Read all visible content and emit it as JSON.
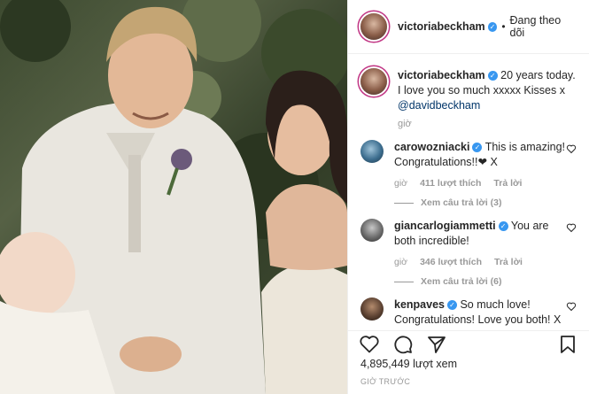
{
  "post": {
    "account": "victoriabeckham",
    "follow_status": "Đang theo dõi"
  },
  "caption": {
    "username": "victoriabeckham",
    "text": "20 years today. I love you so much xxxxx Kisses x",
    "mention": "@davidbeckham",
    "time": "giờ"
  },
  "comments": [
    {
      "username": "carowozniacki",
      "text": "This is amazing! Congratulations!!❤ X",
      "time": "giờ",
      "likes": "411 lượt thích",
      "reply_label": "Trả lời",
      "view_replies": "Xem câu trả lời (3)"
    },
    {
      "username": "giancarlogiammetti",
      "text": "You are both incredible!",
      "time": "giờ",
      "likes": "346 lượt thích",
      "reply_label": "Trả lời",
      "view_replies": "Xem câu trả lời (6)"
    },
    {
      "username": "kenpaves",
      "text": "So much love! Congratulations! Love you both! X"
    }
  ],
  "stats": {
    "views": "4,895,449 lượt xem",
    "posted": "GIỜ TRƯỚC"
  },
  "colors": {
    "verified_badge": "#3897f0",
    "story_ring": "#c13584",
    "link": "#003569"
  },
  "icons": [
    "heart-icon",
    "comment-icon",
    "share-icon",
    "bookmark-icon",
    "verified-icon"
  ]
}
